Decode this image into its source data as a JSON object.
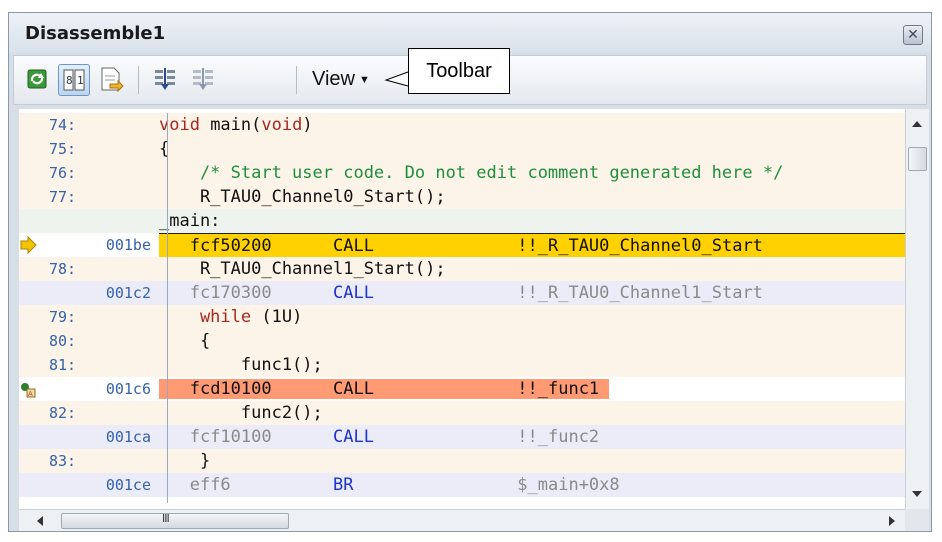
{
  "window": {
    "title": "Disassemble1",
    "close_glyph": "✕"
  },
  "toolbar": {
    "view_label": "View",
    "buttons": [
      {
        "icon": "refresh-icon"
      },
      {
        "icon": "mixed-display-icon"
      },
      {
        "icon": "jump-to-source-icon"
      },
      {
        "icon": "step-in-icon"
      },
      {
        "icon": "step-over-icon"
      }
    ]
  },
  "callout": {
    "label": "Toolbar"
  },
  "colors": {
    "pc_highlight": "#ffd100",
    "breakpoint_highlight": "#ff9a73",
    "source_bg": "#fcf3e9",
    "asm_bg": "#ececf9",
    "keyword": "#a8281d",
    "comment": "#1e8f3b",
    "mnemonic": "#1d35c8",
    "address": "#3463a8"
  },
  "lines": [
    {
      "kind": "src",
      "line": "74:",
      "text_kw": "void",
      "text_mid": " main(",
      "text_kw2": "void",
      "text_end": ")"
    },
    {
      "kind": "src",
      "line": "75:",
      "text": "{"
    },
    {
      "kind": "src",
      "line": "76:",
      "comment": "    /* Start user code. Do not edit comment generated here */"
    },
    {
      "kind": "src",
      "line": "77:",
      "text": "    R_TAU0_Channel0_Start();"
    },
    {
      "kind": "label",
      "text": "_main:"
    },
    {
      "kind": "asm",
      "state": "pc",
      "address": "001be",
      "code": "fcf50200",
      "mnemonic": "CALL",
      "operand": "!!_R_TAU0_Channel0_Start"
    },
    {
      "kind": "src",
      "line": "78:",
      "text": "    R_TAU0_Channel1_Start();"
    },
    {
      "kind": "asm",
      "state": "normal",
      "address": "001c2",
      "code": "fc170300",
      "mnemonic": "CALL",
      "operand": "!!_R_TAU0_Channel1_Start"
    },
    {
      "kind": "src",
      "line": "79:",
      "text_kw": "    while",
      "text_end": " (1U)"
    },
    {
      "kind": "src",
      "line": "80:",
      "text": "    {"
    },
    {
      "kind": "src",
      "line": "81:",
      "text": "        func1();"
    },
    {
      "kind": "asm",
      "state": "breakpoint",
      "address": "001c6",
      "code": "fcd10100",
      "mnemonic": "CALL",
      "operand": "!!_func1"
    },
    {
      "kind": "src",
      "line": "82:",
      "text": "        func2();"
    },
    {
      "kind": "asm",
      "state": "normal",
      "address": "001ca",
      "code": "fcf10100",
      "mnemonic": "CALL",
      "operand": "!!_func2"
    },
    {
      "kind": "src",
      "line": "83:",
      "text": "    }"
    },
    {
      "kind": "asm",
      "state": "normal",
      "address": "001ce",
      "code": "eff6",
      "mnemonic": "BR",
      "operand": "$_main+0x8"
    }
  ],
  "hscroll": {
    "grip": "III"
  }
}
